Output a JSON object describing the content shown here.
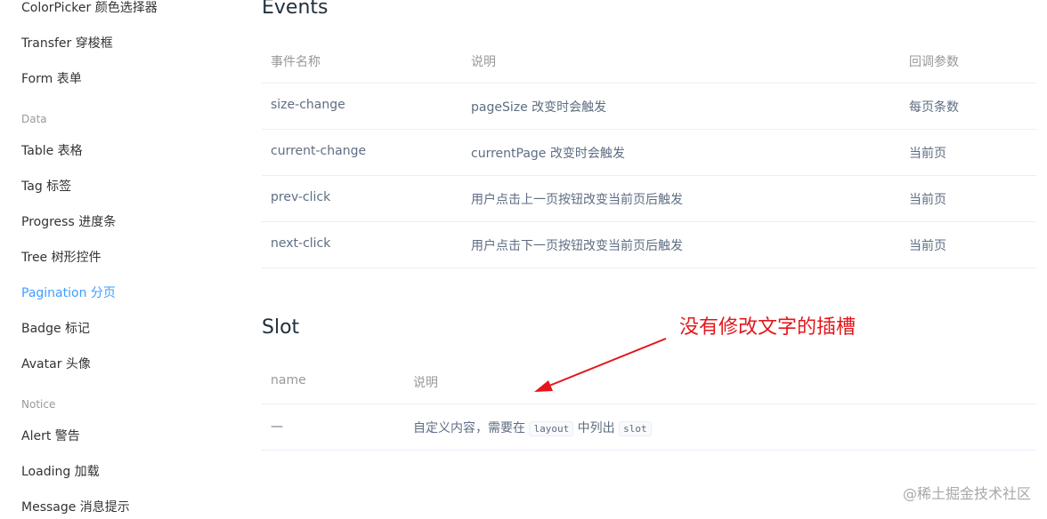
{
  "sidebar": {
    "items": [
      {
        "label": "ColorPicker 颜色选择器"
      },
      {
        "label": "Transfer 穿梭框"
      },
      {
        "label": "Form 表单"
      },
      {
        "group": "Data"
      },
      {
        "label": "Table 表格"
      },
      {
        "label": "Tag 标签"
      },
      {
        "label": "Progress 进度条"
      },
      {
        "label": "Tree 树形控件"
      },
      {
        "label": "Pagination 分页",
        "active": true
      },
      {
        "label": "Badge 标记"
      },
      {
        "label": "Avatar 头像"
      },
      {
        "group": "Notice"
      },
      {
        "label": "Alert 警告"
      },
      {
        "label": "Loading 加载"
      },
      {
        "label": "Message 消息提示"
      }
    ]
  },
  "events": {
    "title": "Events",
    "headers": [
      "事件名称",
      "说明",
      "回调参数"
    ],
    "rows": [
      [
        "size-change",
        "pageSize 改变时会触发",
        "每页条数"
      ],
      [
        "current-change",
        "currentPage 改变时会触发",
        "当前页"
      ],
      [
        "prev-click",
        "用户点击上一页按钮改变当前页后触发",
        "当前页"
      ],
      [
        "next-click",
        "用户点击下一页按钮改变当前页后触发",
        "当前页"
      ]
    ]
  },
  "slot": {
    "title": "Slot",
    "headers": [
      "name",
      "说明"
    ],
    "row": {
      "name": "—",
      "desc_before": "自定义内容，需要在",
      "code1": "layout",
      "desc_middle": "中列出",
      "code2": "slot"
    }
  },
  "annotation": {
    "text": "没有修改文字的插槽",
    "color": "#e4161b"
  },
  "watermark": "@稀土掘金技术社区",
  "colors": {
    "active": "#409eff",
    "heading": "#1f2f3d",
    "body_text": "#5e6d82",
    "border": "#eaeefb"
  }
}
